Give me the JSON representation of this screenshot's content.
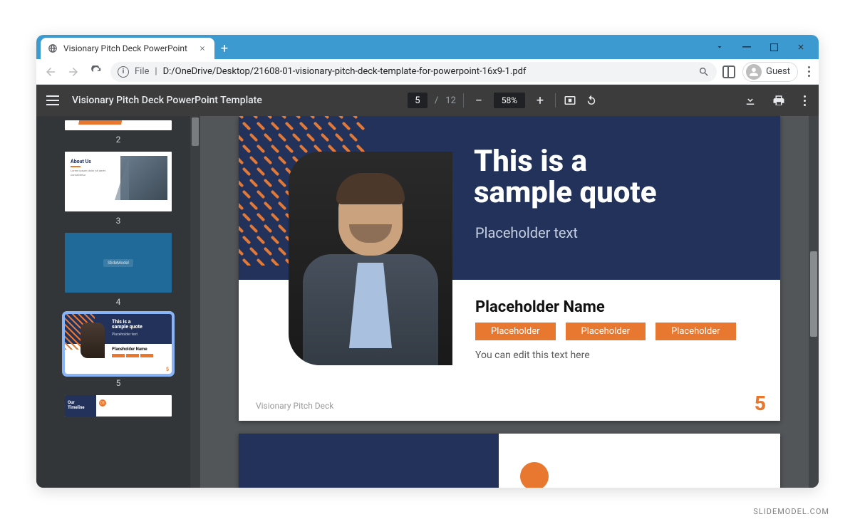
{
  "browser": {
    "tab_title": "Visionary Pitch Deck PowerPoint",
    "file_label": "File",
    "url_path": "D:/OneDrive/Desktop/21608-01-visionary-pitch-deck-template-for-powerpoint-16x9-1.pdf",
    "guest_label": "Guest"
  },
  "pdf_toolbar": {
    "doc_title": "Visionary Pitch Deck PowerPoint Template",
    "current_page": "5",
    "page_sep": "/",
    "total_pages": "12",
    "zoom": "58%"
  },
  "thumbnails": {
    "n2": "2",
    "n3": "3",
    "n4": "4",
    "n5": "5",
    "t3_heading": "About Us",
    "t3_body": "Lorem ipsum dolor sit amet consectetur",
    "t4_logo": "SlideModel",
    "t5_quote": "This is a\nsample quote",
    "t5_sub": "Placeholder text",
    "t5_name": "Placeholder Name",
    "t5_page": "5",
    "t6_label": "Our\nTimeline",
    "t6_num": "01"
  },
  "slide5": {
    "quote_line1": "This is a",
    "quote_line2": "sample quote",
    "subtitle": "Placeholder text",
    "name": "Placeholder Name",
    "tag1": "Placeholder",
    "tag2": "Placeholder",
    "tag3": "Placeholder",
    "edit_hint": "You can edit this text here",
    "deck_label": "Visionary Pitch Deck",
    "page_number": "5"
  },
  "watermark": "SLIDEMODEL.COM"
}
